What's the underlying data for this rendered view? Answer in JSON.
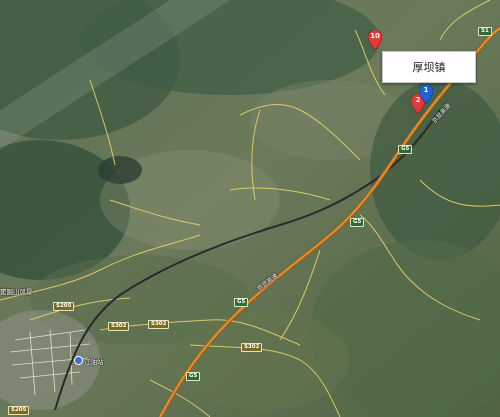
{
  "map": {
    "popup_label": "厚坝镇",
    "markers": [
      {
        "label": "10",
        "color": "#e53935"
      },
      {
        "label": "1",
        "color": "#1e63d6"
      },
      {
        "label": "2",
        "color": "#e53935"
      }
    ],
    "road_labels": {
      "g5_top": "G5",
      "g5_mid": "G5",
      "g5_low": "G5",
      "g5_bottom": "G5",
      "s302_a": "S302",
      "s302_b": "S302",
      "s302_c": "S302",
      "s205_a": "S205",
      "s205_b": "S205",
      "expressway_main": "京昆高速",
      "expressway_upper": "京昆高速",
      "upper_right": "S1"
    },
    "place_labels": {
      "mountain_left": "窦圌山风景",
      "town_left": "江油站"
    },
    "colors": {
      "highway": "#e08a2e",
      "road": "#e6d36a",
      "railway": "#2b2b2b",
      "marker_red": "#e53935",
      "marker_blue": "#1e63d6"
    }
  }
}
